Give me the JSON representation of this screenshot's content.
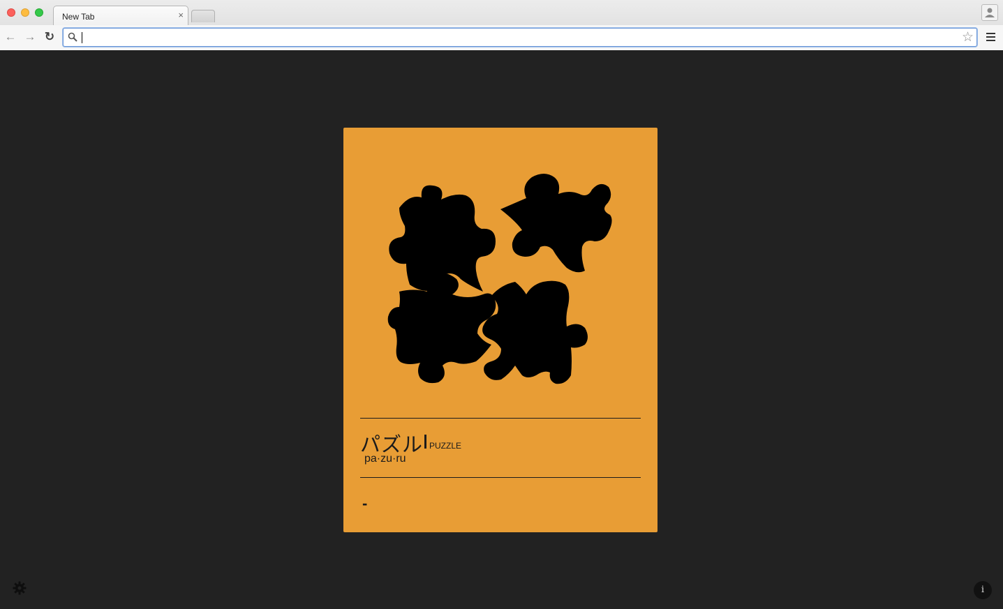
{
  "browser": {
    "tab_title": "New Tab",
    "tab_close": "×",
    "address_value": "",
    "address_placeholder": "",
    "back_glyph": "←",
    "forward_glyph": "→",
    "reload_glyph": "↻",
    "bookmark_glyph": "☆"
  },
  "card": {
    "background": "#e89d35",
    "word": "パズル",
    "meaning": "PUZZLE",
    "romaji": "pa·zu·ru",
    "example": "-",
    "image": "puzzle-pieces-icon"
  },
  "footer": {
    "settings_icon": "gear-icon",
    "info_label": "i"
  }
}
